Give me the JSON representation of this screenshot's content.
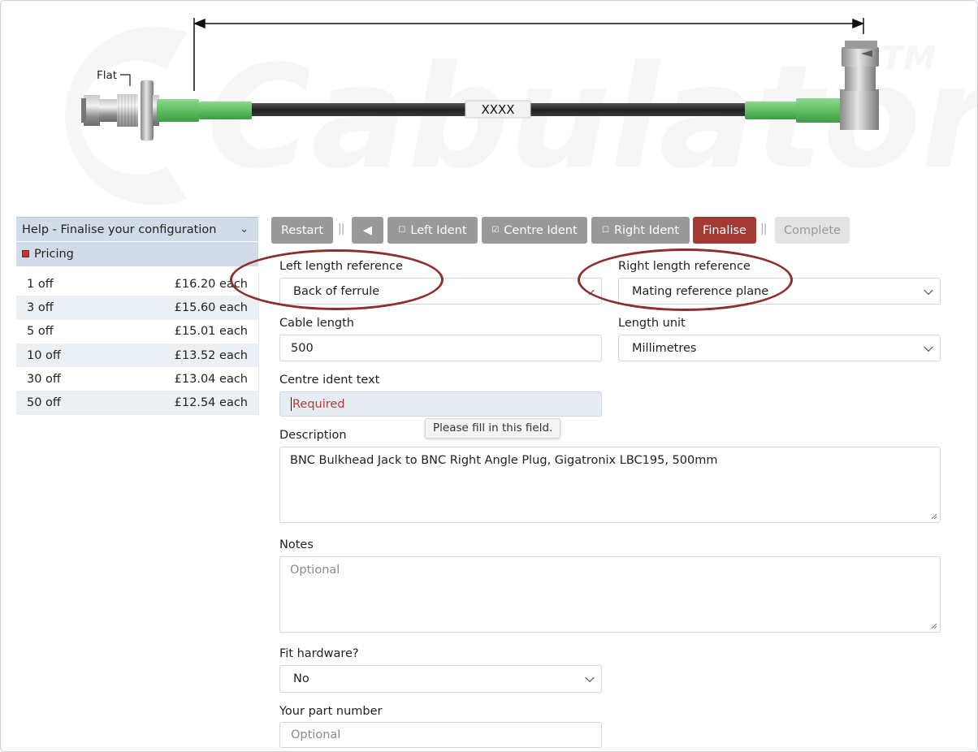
{
  "diagram": {
    "flat_label": "Flat",
    "ident_label": "XXXX",
    "watermark": "Cabulator",
    "trademark": "TM",
    "colors": {
      "heatshrink": "#6fc46f",
      "cable": "#2a2d30",
      "metal": "#9a9a9a"
    }
  },
  "sidebar": {
    "help_title": "Help - Finalise your configuration",
    "pricing_title": "Pricing",
    "price_rows": [
      {
        "qty": "1 off",
        "price": "£16.20 each"
      },
      {
        "qty": "3 off",
        "price": "£15.60 each"
      },
      {
        "qty": "5 off",
        "price": "£15.01 each"
      },
      {
        "qty": "10 off",
        "price": "£13.52 each"
      },
      {
        "qty": "30 off",
        "price": "£13.04 each"
      },
      {
        "qty": "50 off",
        "price": "£12.54 each"
      }
    ]
  },
  "toolbar": {
    "restart": "Restart",
    "back": "◀",
    "left_ident": "Left Ident",
    "centre_ident": "Centre Ident",
    "right_ident": "Right Ident",
    "finalise": "Finalise",
    "complete": "Complete",
    "separator": "||",
    "checkbox_unchecked": "☐",
    "checkbox_checked": "☑"
  },
  "form": {
    "left_ref_label": "Left length reference",
    "left_ref_value": "Back of ferrule",
    "right_ref_label": "Right length reference",
    "right_ref_value": "Mating reference plane",
    "cable_length_label": "Cable length",
    "cable_length_value": "500",
    "length_unit_label": "Length unit",
    "length_unit_value": "Millimetres",
    "centre_ident_label": "Centre ident text",
    "centre_ident_placeholder": "Required",
    "tooltip": "Please fill in this field.",
    "description_label": "Description",
    "description_value": "BNC Bulkhead Jack to BNC Right Angle Plug, Gigatronix LBC195, 500mm",
    "notes_label": "Notes",
    "notes_placeholder": "Optional",
    "fit_hardware_label": "Fit hardware?",
    "fit_hardware_value": "No",
    "part_number_label": "Your part number",
    "part_number_placeholder": "Optional"
  },
  "colors": {
    "accent": "#a33a34",
    "highlight_ring": "#8d2f2c",
    "toolbar_button": "#999999"
  }
}
